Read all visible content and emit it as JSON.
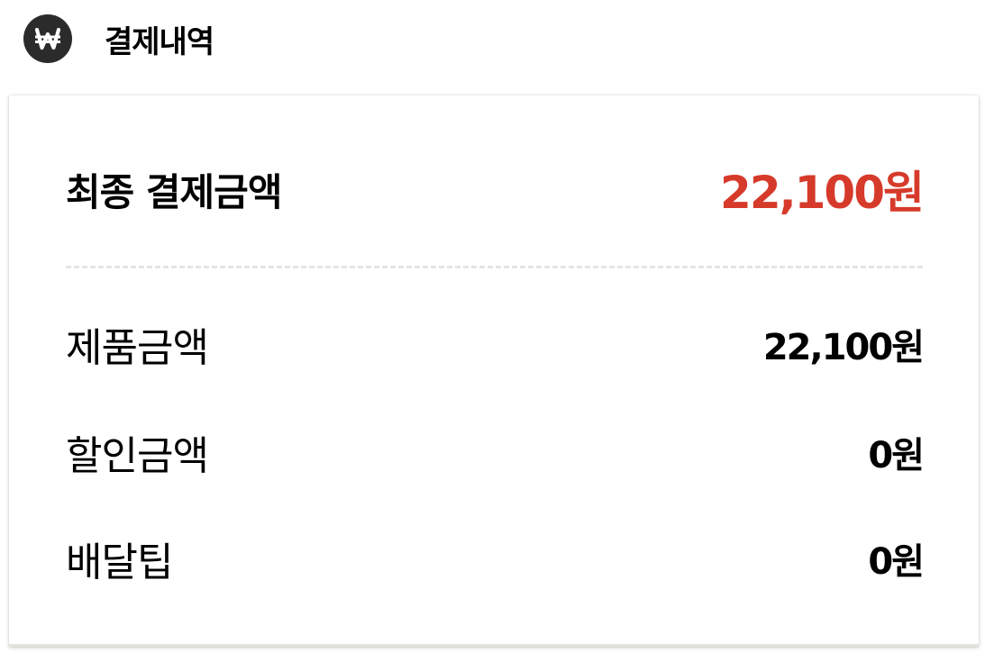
{
  "header": {
    "icon": "won-icon",
    "title": "결제내역"
  },
  "summary": {
    "total_label": "최종 결제금액",
    "total_value": "22,100원",
    "total_color": "#d63a2a"
  },
  "items": [
    {
      "label": "제품금액",
      "value": "22,100원"
    },
    {
      "label": "할인금액",
      "value": "0원"
    },
    {
      "label": "배달팁",
      "value": "0원"
    }
  ]
}
